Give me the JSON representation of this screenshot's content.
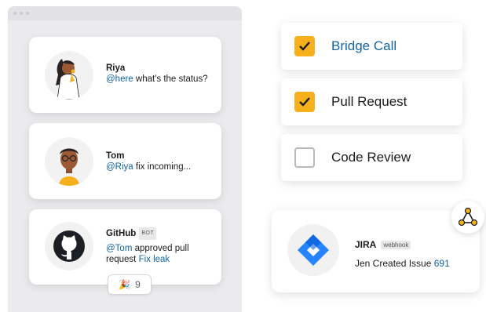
{
  "messages": [
    {
      "author": "Riya",
      "mention": "@here",
      "text": " what's the status?"
    },
    {
      "author": "Tom",
      "mention": "@Riya",
      "text": " fix incoming..."
    },
    {
      "author": "GitHub",
      "badge": "BOT",
      "mention": "@Tom",
      "text": " approved pull request ",
      "link": "Fix leak"
    }
  ],
  "reaction": {
    "emoji": "🎉",
    "count": "9"
  },
  "checklist": [
    {
      "label": "Bridge Call",
      "checked": true,
      "color": "#1264a3"
    },
    {
      "label": "Pull Request",
      "checked": true,
      "color": "#1d1c1d"
    },
    {
      "label": "Code Review",
      "checked": false,
      "color": "#1d1c1d"
    }
  ],
  "jira": {
    "title": "JIRA",
    "badge": "webhook",
    "text": "Jen Created Issue ",
    "issue": "691"
  },
  "colors": {
    "accent": "#1264a3",
    "check": "#f5b01b",
    "jira_blue": "#2684ff"
  },
  "icons": [
    "riya-avatar",
    "tom-avatar",
    "github-icon",
    "party-popper-icon",
    "checkbox-icon",
    "jira-icon",
    "webhook-icon"
  ]
}
